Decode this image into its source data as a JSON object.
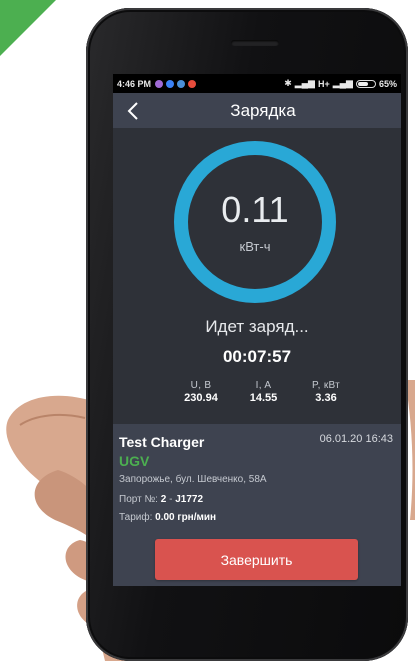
{
  "status_bar": {
    "time": "4:46 PM",
    "network": "H+",
    "battery": "65%",
    "battery_level": 0.65
  },
  "app_bar": {
    "title": "Зарядка",
    "back_icon": "chevron-left-icon"
  },
  "gauge": {
    "value": "0.11",
    "unit": "кВт-ч",
    "ring_color": "#29a8d6"
  },
  "charging": {
    "status": "Идет заряд...",
    "timer": "00:07:57"
  },
  "metrics": [
    {
      "label": "U,  B",
      "value": "230.94"
    },
    {
      "label": "I,  A",
      "value": "14.55"
    },
    {
      "label": "P,  кВт",
      "value": "3.36"
    }
  ],
  "charger": {
    "name": "Test Charger",
    "datetime": "06.01.20 16:43",
    "brand": "UGV",
    "brand_color": "#4caf50",
    "address": "Запорожье, бул. Шевченко, 58А",
    "port_label": "Порт №:",
    "port_number": "2",
    "port_separator": "-",
    "port_type": "J1772",
    "tariff_label": "Тариф:",
    "tariff_value": "0.00 грн/мин"
  },
  "finish_button": {
    "label": "Завершить",
    "color": "#d9534f"
  }
}
